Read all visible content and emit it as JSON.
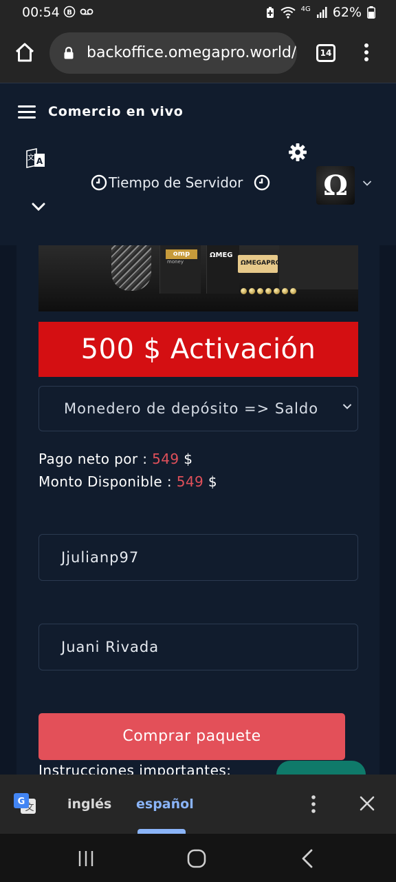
{
  "status_bar": {
    "time": "00:54",
    "network": "4G",
    "battery": "62%"
  },
  "browser": {
    "url": "backoffice.omegapro.world/",
    "tab_count": "14"
  },
  "header": {
    "menu_title": "Comercio en vivo",
    "server_time_label": "Tiempo de Servidor"
  },
  "banner": {
    "logo_omp": "omp",
    "logo_omp_sub": "money",
    "logo_mega": "MEG",
    "logo_omegapro": "MEGAPRO"
  },
  "main": {
    "activation_title": "500 $ Activación",
    "wallet_select": "Monedero de depósito => Saldo",
    "net_payment_label": "Pago neto por : ",
    "net_payment_value": "549",
    "available_label": "Monto Disponible : ",
    "available_value": "549",
    "currency": "$",
    "username_value": "Jjulianp97",
    "fullname_value": "Juani Rivada",
    "buy_button": "Comprar paquete",
    "instructions_heading": "Instrucciones importantes:"
  },
  "translate": {
    "lang_source": "inglés",
    "lang_target": "español"
  },
  "colors": {
    "accent_red": "#d40f12",
    "button_red": "#e35059",
    "value_red": "#e0505a",
    "panel_bg": "#111c2d",
    "link_blue": "#8ab4f8"
  }
}
